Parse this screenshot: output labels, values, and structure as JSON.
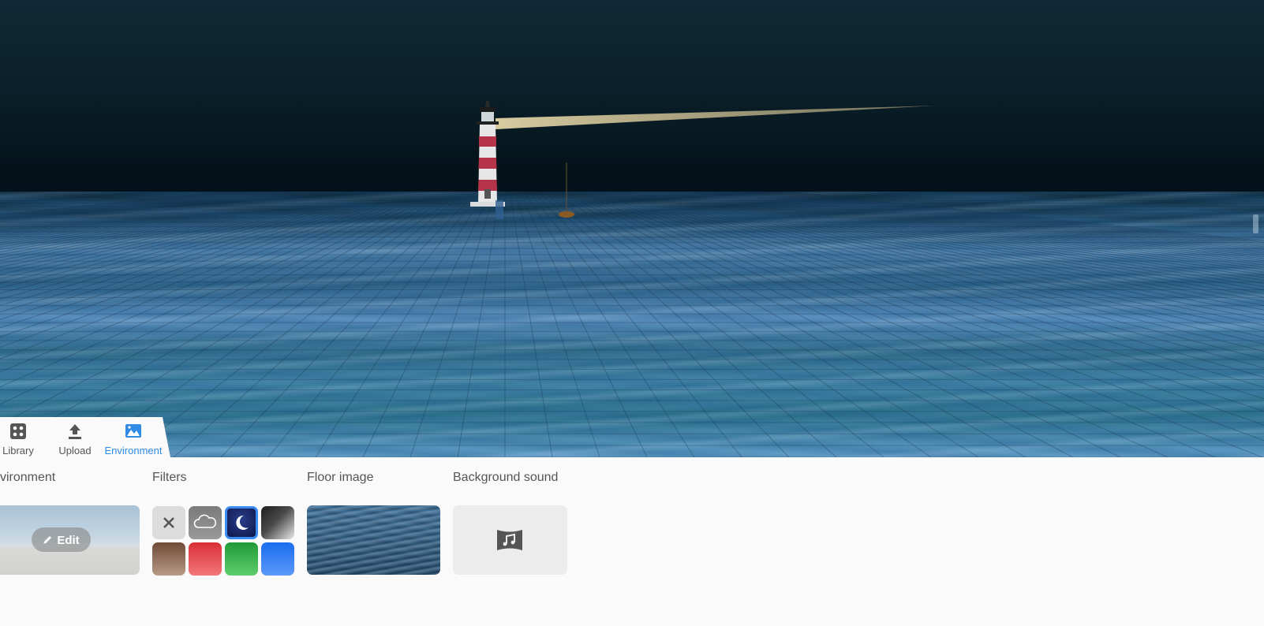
{
  "tabs": [
    {
      "label": "Library",
      "icon": "library-grid-icon",
      "active": false
    },
    {
      "label": "Upload",
      "icon": "upload-arrow-icon",
      "active": false
    },
    {
      "label": "Environment",
      "icon": "environment-landscape-icon",
      "active": true
    }
  ],
  "sections": {
    "environment": {
      "title": "vironment",
      "edit_label": "Edit"
    },
    "filters": {
      "title": "Filters",
      "options": [
        {
          "name": "none",
          "icon": "close-icon",
          "selected": false
        },
        {
          "name": "cloudy",
          "icon": "cloud-icon",
          "selected": false
        },
        {
          "name": "night",
          "icon": "moon-icon",
          "selected": true
        },
        {
          "name": "grayscale",
          "color": "#555555",
          "selected": false
        },
        {
          "name": "sepia",
          "color": "#8b6a55",
          "selected": false
        },
        {
          "name": "red",
          "color": "#e8464a",
          "selected": false
        },
        {
          "name": "green",
          "color": "#35b24a",
          "selected": false
        },
        {
          "name": "blue",
          "color": "#2f7cf2",
          "selected": false
        }
      ]
    },
    "floor_image": {
      "title": "Floor image"
    },
    "background_sound": {
      "title": "Background sound",
      "icon": "music-note-icon"
    }
  },
  "colors": {
    "accent": "#2f8be6",
    "selected_border": "#3b8cf2"
  }
}
